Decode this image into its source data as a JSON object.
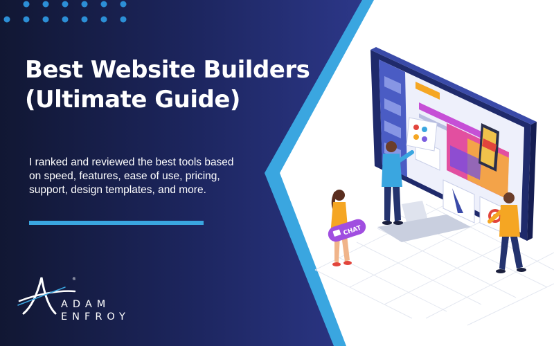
{
  "headline": {
    "line1": "Best Website Builders",
    "line2": "(Ultimate Guide)"
  },
  "description": {
    "line1": "I ranked and reviewed the best tools based",
    "line2": "on speed, features, ease of use, pricing,",
    "line3": "support, design templates, and more."
  },
  "brand": {
    "line1": "ADAM",
    "line2": "ENFROY",
    "trademark": "®"
  },
  "illustration": {
    "chat_label": "CHAT"
  },
  "colors": {
    "panel_dark": "#121838",
    "panel_mid": "#2a3582",
    "accent_blue": "#3aa6e0",
    "dot_blue": "#2c8fd6"
  }
}
